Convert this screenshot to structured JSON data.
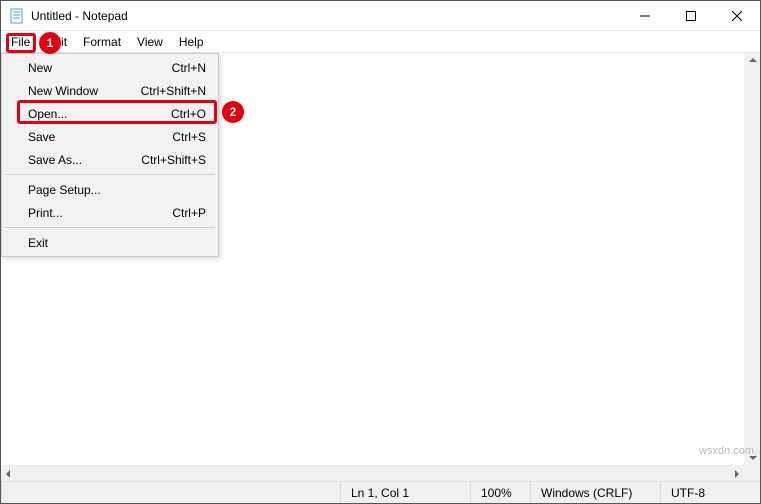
{
  "window": {
    "title": "Untitled - Notepad"
  },
  "menubar": {
    "file": "File",
    "edit": "Edit",
    "format": "Format",
    "view": "View",
    "help": "Help"
  },
  "file_menu": {
    "items": [
      {
        "label": "New",
        "shortcut": "Ctrl+N"
      },
      {
        "label": "New Window",
        "shortcut": "Ctrl+Shift+N"
      },
      {
        "label": "Open...",
        "shortcut": "Ctrl+O"
      },
      {
        "label": "Save",
        "shortcut": "Ctrl+S"
      },
      {
        "label": "Save As...",
        "shortcut": "Ctrl+Shift+S"
      },
      {
        "label": "Page Setup...",
        "shortcut": ""
      },
      {
        "label": "Print...",
        "shortcut": "Ctrl+P"
      },
      {
        "label": "Exit",
        "shortcut": ""
      }
    ]
  },
  "statusbar": {
    "position": "Ln 1, Col 1",
    "zoom": "100%",
    "line_ending": "Windows (CRLF)",
    "encoding": "UTF-8"
  },
  "annotations": {
    "badge1": "1",
    "badge2": "2"
  },
  "watermark": "wsxdn.com"
}
